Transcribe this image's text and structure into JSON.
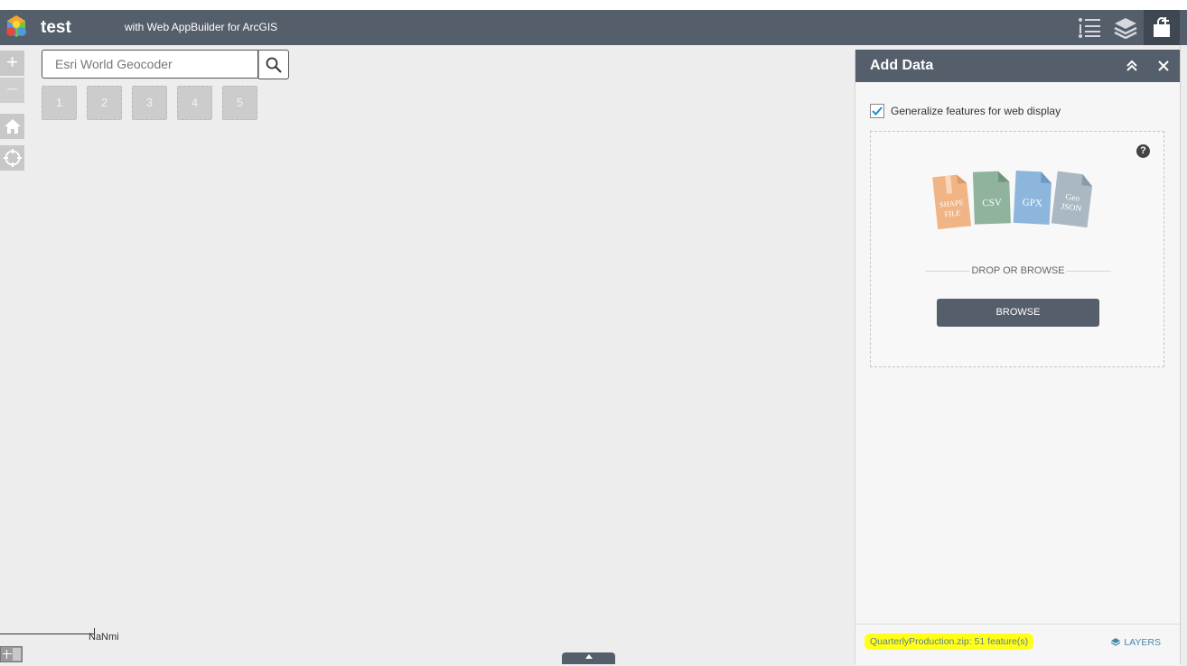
{
  "header": {
    "title": "test",
    "subtitle": "with Web AppBuilder for ArcGIS"
  },
  "map": {
    "zoom_in_label": "+",
    "zoom_out_label": "−",
    "search": {
      "placeholder": "Esri World Geocoder",
      "value": ""
    },
    "bookmarks": [
      "1",
      "2",
      "3",
      "4",
      "5"
    ],
    "scale_label": "NaNmi"
  },
  "panel": {
    "title": "Add Data",
    "generalize_label": "Generalize features for web display",
    "generalize_checked": true,
    "help_label": "?",
    "file_types": [
      "SHAPE FILE",
      "CSV",
      "GPX",
      "Geo JSON"
    ],
    "drop_label": "DROP OR BROWSE",
    "browse_label": "BROWSE",
    "status": "QuarterlyProduction.zip: 51 feature(s)",
    "layers_label": "LAYERS"
  },
  "colors": {
    "header": "#555e6b",
    "map_bg": "#ededed",
    "highlight": "#ffff1a",
    "file_shape": "#f0b485",
    "file_csv": "#8fb39c",
    "file_gpx": "#8db6dd",
    "file_geojson": "#a9b8c2"
  }
}
